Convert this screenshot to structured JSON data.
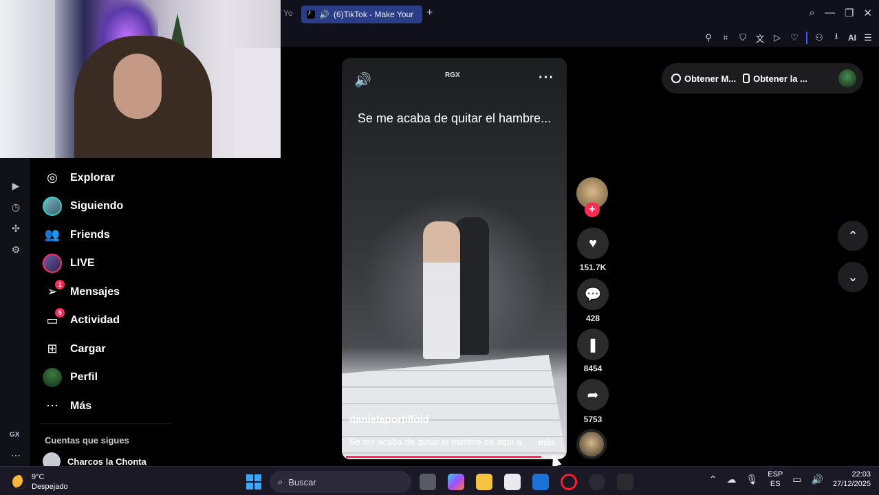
{
  "browser": {
    "tab_partial": "Yo",
    "active_tab": "(6)TikTok - Make Your",
    "new_tab": "+",
    "window_controls": [
      "search-icon",
      "minimize-icon",
      "restore-icon",
      "close-icon"
    ],
    "toolbar_ai_label": "AI"
  },
  "sidebar": {
    "items": [
      {
        "label": "Explorar",
        "icon": "compass-icon"
      },
      {
        "label": "Siguiendo",
        "icon": "avatar"
      },
      {
        "label": "Friends",
        "icon": "friends-icon"
      },
      {
        "label": "LIVE",
        "icon": "avatar"
      },
      {
        "label": "Mensajes",
        "icon": "send-icon",
        "badge": "1"
      },
      {
        "label": "Actividad",
        "icon": "message-icon",
        "badge": "5"
      },
      {
        "label": "Cargar",
        "icon": "plus-square-icon"
      },
      {
        "label": "Perfil",
        "icon": "avatar"
      },
      {
        "label": "Más",
        "icon": "ellipsis-icon"
      }
    ],
    "following_title": "Cuentas que sigues",
    "following": [
      {
        "name": "Charcos la Chonta"
      }
    ],
    "rail_label": "GX"
  },
  "video": {
    "logo": "RGX",
    "caption": "Se me acaba de quitar el hambre...",
    "author": "danielaportilloid",
    "description": "Se me acaba de quitar el hambre de aquí a",
    "more": "más",
    "progress": 0.9
  },
  "actions": {
    "likes": "151.7K",
    "comments": "428",
    "saves": "8454",
    "shares": "5753"
  },
  "right_panel": {
    "get_app_1": "Obtener M...",
    "get_app_2": "Obtener la ..."
  },
  "taskbar": {
    "temperature": "9°C",
    "weather": "Despejado",
    "search_placeholder": "Buscar",
    "lang_1": "ESP",
    "lang_2": "ES",
    "time": "22:03",
    "date": "27/12/2025"
  },
  "colors": {
    "accent": "#fe2c55",
    "tab_active": "#2a3d86"
  }
}
